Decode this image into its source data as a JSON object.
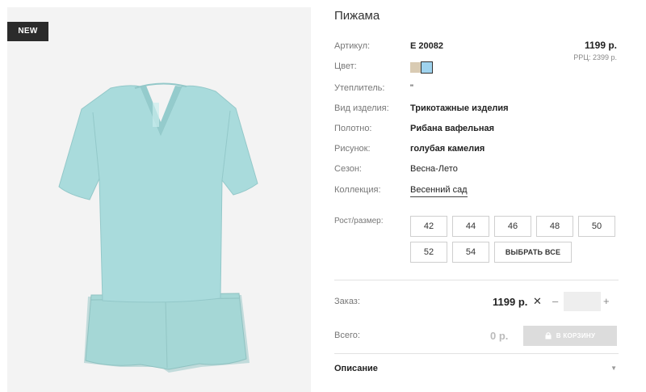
{
  "product": {
    "badge": "NEW",
    "title": "Пижама",
    "price": "1199 р.",
    "rrp": "РРЦ: 2399 р."
  },
  "attributes": [
    {
      "label": "Артикул:",
      "value": "Е 20082"
    },
    {
      "label": "Цвет:",
      "value": ""
    },
    {
      "label": "Утеплитель:",
      "value": "\""
    },
    {
      "label": "Вид изделия:",
      "value": "Трикотажные изделия"
    },
    {
      "label": "Полотно:",
      "value": "Рибана вафельная"
    },
    {
      "label": "Рисунок:",
      "value": "голубая камелия"
    },
    {
      "label": "Сезон:",
      "value": "Весна-Лето"
    },
    {
      "label": "Коллекция:",
      "value": "Весенний сад"
    }
  ],
  "colors": {
    "swatches": [
      "#d9cbb3",
      "#9fd3ee"
    ],
    "selected_index": 1
  },
  "sizes": {
    "label": "Рост/размер:",
    "options": [
      "42",
      "44",
      "46",
      "48",
      "50",
      "52",
      "54"
    ],
    "select_all": "ВЫБРАТЬ ВСЕ"
  },
  "order": {
    "label": "Заказ:",
    "price": "1199 р.",
    "times_symbol": "✕",
    "minus": "–",
    "plus": "+",
    "quantity": ""
  },
  "total": {
    "label": "Всего:",
    "value": "0 р.",
    "cart_button": "В КОРЗИНУ"
  },
  "description": {
    "label": "Описание",
    "toggle_icon": "chevron-down-icon"
  }
}
